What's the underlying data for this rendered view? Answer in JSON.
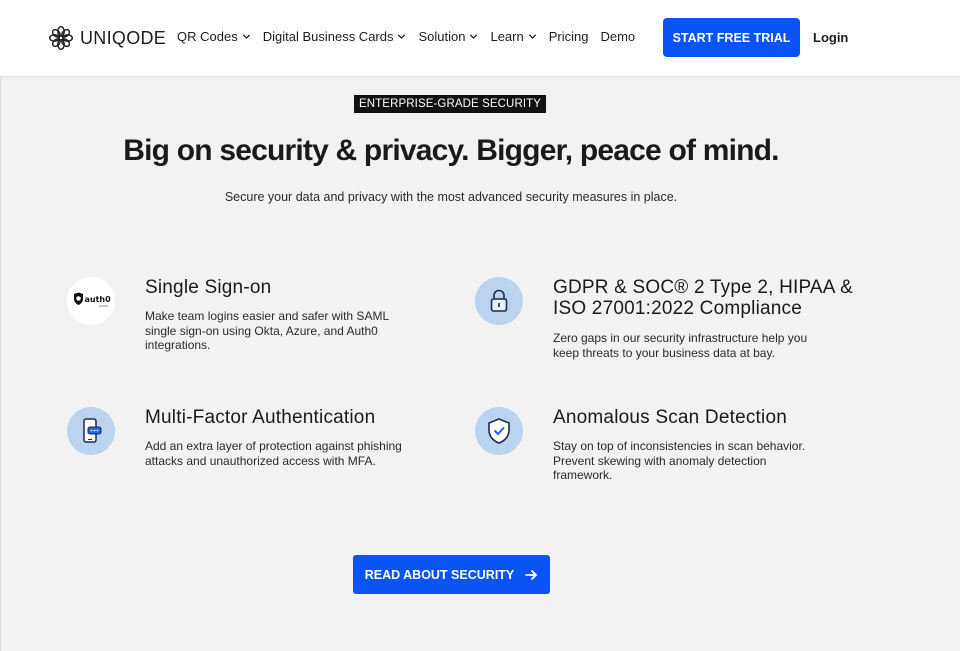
{
  "header": {
    "logo_text": "UNIQODE",
    "nav": [
      {
        "label": "QR Codes",
        "dropdown": true
      },
      {
        "label": "Digital Business Cards",
        "dropdown": true
      },
      {
        "label": "Solution",
        "dropdown": true
      },
      {
        "label": "Learn",
        "dropdown": true
      },
      {
        "label": "Pricing",
        "dropdown": false
      },
      {
        "label": "Demo",
        "dropdown": false
      }
    ],
    "cta_label": "START FREE TRIAL",
    "login_label": "Login"
  },
  "hero": {
    "badge": "ENTERPRISE-GRADE SECURITY",
    "headline": "Big on security & privacy. Bigger, peace of mind.",
    "subline": "Secure your data and privacy with the most advanced security measures in place."
  },
  "features": [
    {
      "icon": "auth0-logo",
      "icon_text": "auth0",
      "title": "Single Sign-on",
      "desc": [
        "Make team logins easier and safer with SAML",
        "single sign-on using Okta, Azure, and Auth0",
        "integrations."
      ]
    },
    {
      "icon": "lock-icon",
      "title": [
        "GDPR & SOC® 2 Type 2, HIPAA &",
        "ISO 27001:2022 Compliance"
      ],
      "desc": [
        "Zero gaps in our security infrastructure help you",
        "keep threats to your business data at bay."
      ]
    },
    {
      "icon": "phone-chat-icon",
      "title": "Multi-Factor Authentication",
      "desc": [
        "Add an extra layer of protection against phishing",
        "attacks and unauthorized access with MFA."
      ]
    },
    {
      "icon": "shield-check-icon",
      "title": "Anomalous Scan Detection",
      "desc": [
        "Stay on top of inconsistencies in scan behavior.",
        "Prevent skewing with anomaly detection",
        "framework."
      ]
    }
  ],
  "cta": {
    "label": "READ ABOUT SECURITY"
  },
  "colors": {
    "accent": "#0a54f5",
    "icon_bg": "#bcd3f0",
    "background": "#f2f2f2"
  }
}
